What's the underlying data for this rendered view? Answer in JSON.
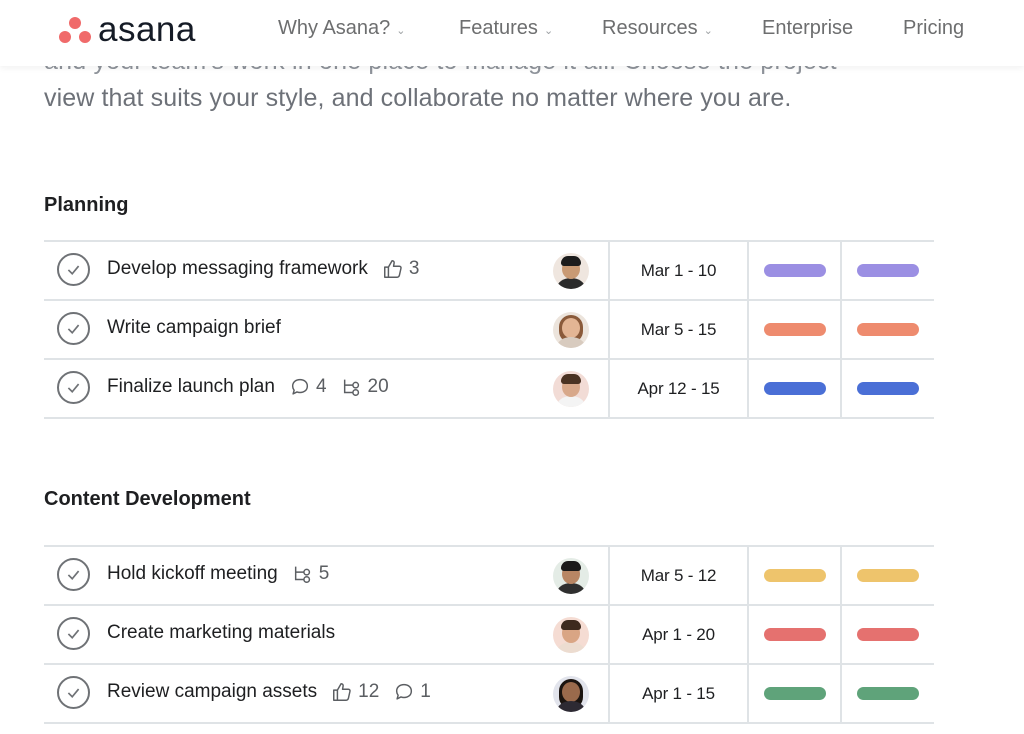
{
  "brand": {
    "name": "asana",
    "color": "#f06a6a"
  },
  "nav": {
    "why": "Why Asana?",
    "features": "Features",
    "resources": "Resources",
    "enterprise": "Enterprise",
    "pricing": "Pricing"
  },
  "intro": {
    "partial_line": "and your team's work in one place to manage it all. Choose the project",
    "line": "view that suits your style, and collaborate no matter where you are."
  },
  "sections": [
    {
      "title": "Planning",
      "tasks": [
        {
          "name": "Develop messaging framework",
          "likes": "3",
          "date": "Mar 1 - 10",
          "color": "#9b8fe3",
          "avatar": "person-1"
        },
        {
          "name": "Write campaign brief",
          "date": "Mar 5 - 15",
          "color": "#ee8b6e",
          "avatar": "person-2"
        },
        {
          "name": "Finalize launch plan",
          "comments": "4",
          "subtasks": "20",
          "date": "Apr 12 - 15",
          "color": "#4a6fd6",
          "avatar": "person-3"
        }
      ]
    },
    {
      "title": "Content Development",
      "tasks": [
        {
          "name": "Hold kickoff meeting",
          "subtasks": "5",
          "date": "Mar 5 - 12",
          "color": "#eec46c",
          "avatar": "person-4"
        },
        {
          "name": "Create marketing materials",
          "date": "Apr 1 - 20",
          "color": "#e5716f",
          "avatar": "person-5"
        },
        {
          "name": "Review campaign assets",
          "likes": "12",
          "comments": "1",
          "date": "Apr 1 - 15",
          "color": "#5fa37a",
          "avatar": "person-6"
        }
      ]
    }
  ]
}
